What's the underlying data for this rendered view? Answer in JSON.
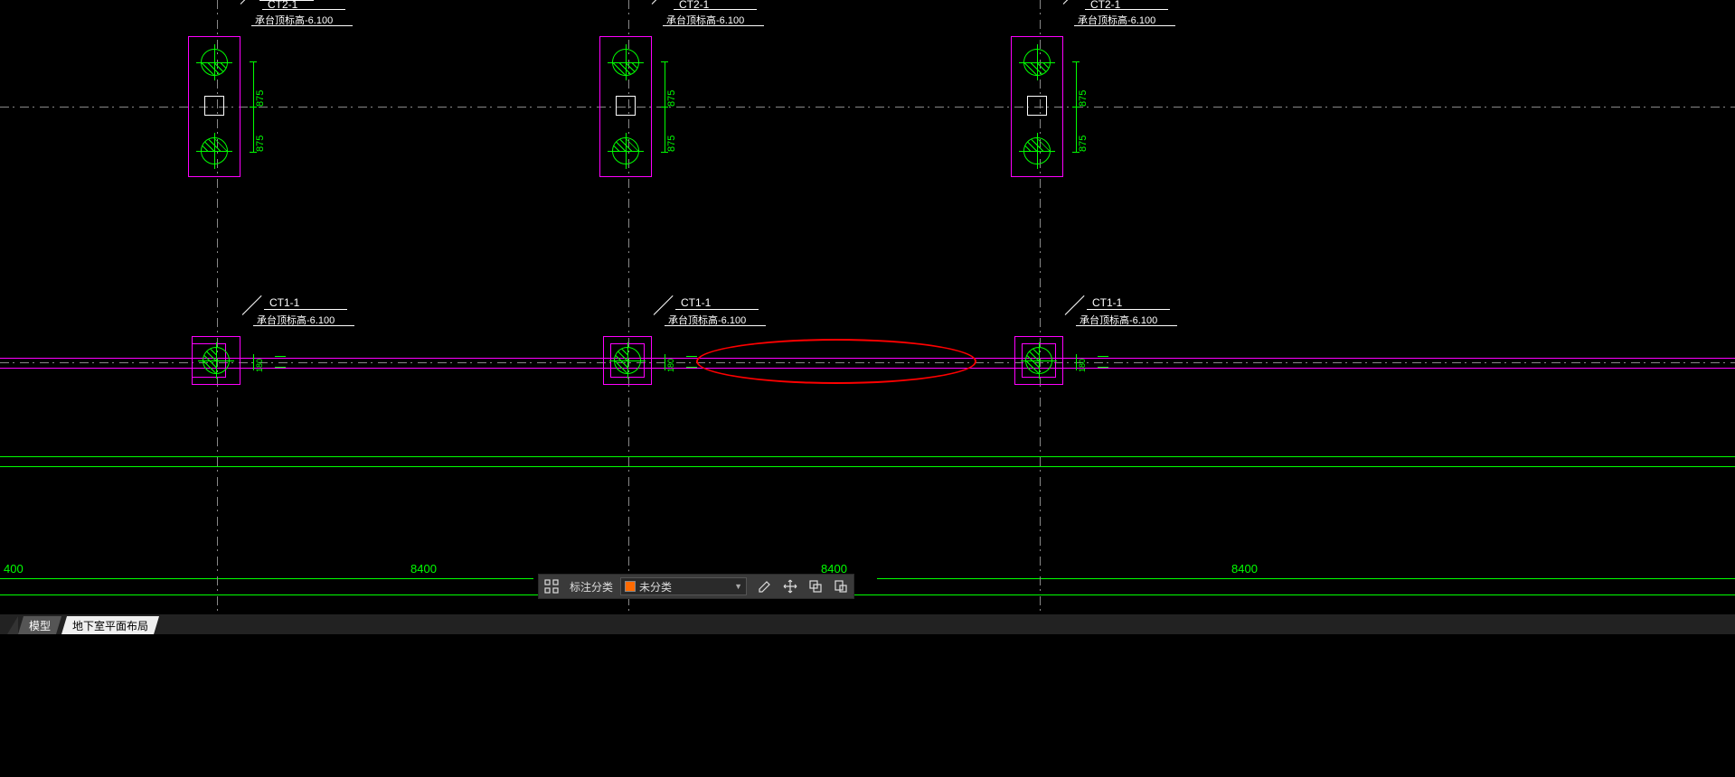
{
  "ct2": {
    "tag": "CT2-1",
    "elev_label": "承台顶标高-6.100",
    "dims": [
      "875",
      "875"
    ]
  },
  "ct1": {
    "tag": "CT1-1",
    "elev_label": "承台顶标高-6.100",
    "dim": "180"
  },
  "baseline_dims": {
    "left_edge": "400",
    "span": "8400"
  },
  "toolbar": {
    "label_class": "标注分类",
    "select_value": "未分类"
  },
  "tabs": {
    "model": "模型",
    "layout1": "地下室平面布局"
  }
}
